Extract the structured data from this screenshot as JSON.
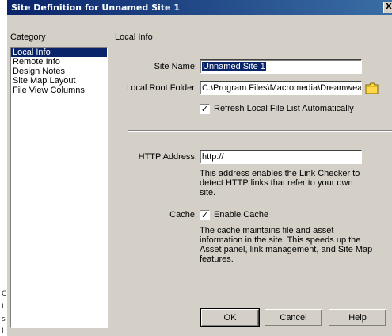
{
  "window": {
    "title": "Site Definition for Unnamed Site 1",
    "close_glyph": "X"
  },
  "background_glyphs": [
    "C",
    "I",
    "s",
    "I"
  ],
  "category": {
    "header": "Category",
    "items": [
      "Local Info",
      "Remote Info",
      "Design Notes",
      "Site Map Layout",
      "File View Columns"
    ],
    "selected_index": 0
  },
  "panel": {
    "title": "Local Info",
    "site_name": {
      "label": "Site Name:",
      "value": "Unnamed Site 1"
    },
    "local_root": {
      "label": "Local Root Folder:",
      "value": "C:\\Program Files\\Macromedia\\Dreamweav",
      "icon": "folder-icon"
    },
    "refresh": {
      "label": "Refresh Local File List Automatically",
      "checked": true
    },
    "http": {
      "label": "HTTP Address:",
      "value": "http://",
      "description": [
        "This address enables the Link Checker to",
        "detect HTTP links that refer to your own",
        "site."
      ]
    },
    "cache": {
      "label": "Cache:",
      "checkbox_label": "Enable Cache",
      "checked": true,
      "description": [
        "The cache maintains file and asset",
        "information in the site.  This speeds up the",
        "Asset panel, link management, and Site Map",
        "features."
      ]
    }
  },
  "buttons": {
    "ok": "OK",
    "cancel": "Cancel",
    "help": "Help"
  },
  "colors": {
    "titlebar": "#0a246a",
    "face": "#d4d0c8",
    "selection": "#0a246a"
  }
}
